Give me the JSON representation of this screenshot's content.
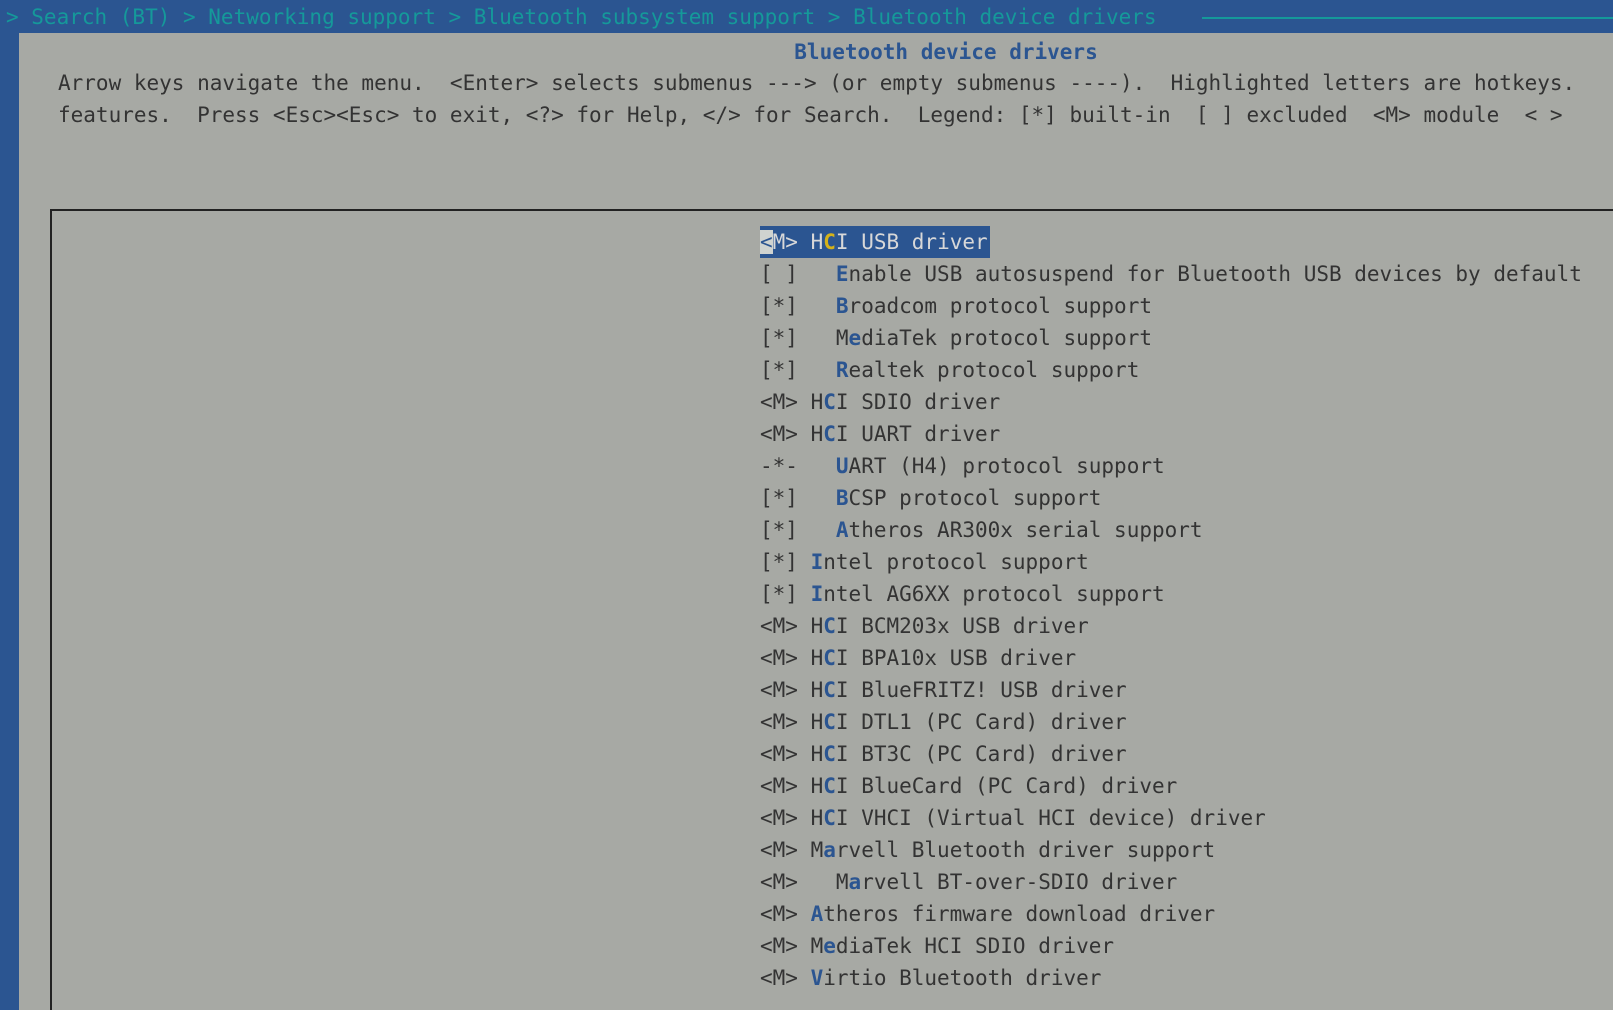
{
  "breadcrumb": "> Search (BT) > Networking support > Bluetooth subsystem support > Bluetooth device drivers",
  "title": "Bluetooth device drivers",
  "help": {
    "line1": "Arrow keys navigate the menu.  <Enter> selects submenus ---> (or empty submenus ----).  Highlighted letters are hotkeys.",
    "line2": "features.  Press <Esc><Esc> to exit, <?> for Help, </> for Search.  Legend: [*] built-in  [ ] excluded  <M> module  < >"
  },
  "colors": {
    "frame_blue": "#2b5591",
    "panel_gray": "#a7a9a4",
    "breadcrumb_teal": "#15999a",
    "hotkey_selected": "#d4b21a"
  },
  "menu": [
    {
      "state": "<M>",
      "indent": "",
      "hot": "C",
      "hot_index": 1,
      "label": "HCI USB driver",
      "selected": true
    },
    {
      "state": "[ ]",
      "indent": "  ",
      "hot": "E",
      "hot_index": 0,
      "label": "Enable USB autosuspend for Bluetooth USB devices by default",
      "selected": false
    },
    {
      "state": "[*]",
      "indent": "  ",
      "hot": "B",
      "hot_index": 0,
      "label": "Broadcom protocol support",
      "selected": false
    },
    {
      "state": "[*]",
      "indent": "  ",
      "hot": "e",
      "hot_index": 1,
      "label": "MediaTek protocol support",
      "selected": false
    },
    {
      "state": "[*]",
      "indent": "  ",
      "hot": "R",
      "hot_index": 0,
      "label": "Realtek protocol support",
      "selected": false
    },
    {
      "state": "<M>",
      "indent": "",
      "hot": "C",
      "hot_index": 1,
      "label": "HCI SDIO driver",
      "selected": false
    },
    {
      "state": "<M>",
      "indent": "",
      "hot": "C",
      "hot_index": 1,
      "label": "HCI UART driver",
      "selected": false
    },
    {
      "state": "-*-",
      "indent": "  ",
      "hot": "U",
      "hot_index": 0,
      "label": "UART (H4) protocol support",
      "selected": false
    },
    {
      "state": "[*]",
      "indent": "  ",
      "hot": "B",
      "hot_index": 0,
      "label": "BCSP protocol support",
      "selected": false
    },
    {
      "state": "[*]",
      "indent": "  ",
      "hot": "A",
      "hot_index": 0,
      "label": "Atheros AR300x serial support",
      "selected": false
    },
    {
      "state": "[*]",
      "indent": "",
      "hot": "I",
      "hot_index": 0,
      "label": "Intel protocol support",
      "selected": false
    },
    {
      "state": "[*]",
      "indent": "",
      "hot": "I",
      "hot_index": 0,
      "label": "Intel AG6XX protocol support",
      "selected": false
    },
    {
      "state": "<M>",
      "indent": "",
      "hot": "C",
      "hot_index": 1,
      "label": "HCI BCM203x USB driver",
      "selected": false
    },
    {
      "state": "<M>",
      "indent": "",
      "hot": "C",
      "hot_index": 1,
      "label": "HCI BPA10x USB driver",
      "selected": false
    },
    {
      "state": "<M>",
      "indent": "",
      "hot": "C",
      "hot_index": 1,
      "label": "HCI BlueFRITZ! USB driver",
      "selected": false
    },
    {
      "state": "<M>",
      "indent": "",
      "hot": "C",
      "hot_index": 1,
      "label": "HCI DTL1 (PC Card) driver",
      "selected": false
    },
    {
      "state": "<M>",
      "indent": "",
      "hot": "C",
      "hot_index": 1,
      "label": "HCI BT3C (PC Card) driver",
      "selected": false
    },
    {
      "state": "<M>",
      "indent": "",
      "hot": "C",
      "hot_index": 1,
      "label": "HCI BlueCard (PC Card) driver",
      "selected": false
    },
    {
      "state": "<M>",
      "indent": "",
      "hot": "C",
      "hot_index": 1,
      "label": "HCI VHCI (Virtual HCI device) driver",
      "selected": false
    },
    {
      "state": "<M>",
      "indent": "",
      "hot": "a",
      "hot_index": 1,
      "label": "Marvell Bluetooth driver support",
      "selected": false
    },
    {
      "state": "<M>",
      "indent": "  ",
      "hot": "a",
      "hot_index": 1,
      "label": "Marvell BT-over-SDIO driver",
      "selected": false
    },
    {
      "state": "<M>",
      "indent": "",
      "hot": "A",
      "hot_index": 0,
      "label": "Atheros firmware download driver",
      "selected": false
    },
    {
      "state": "<M>",
      "indent": "",
      "hot": "e",
      "hot_index": 1,
      "label": "MediaTek HCI SDIO driver",
      "selected": false
    },
    {
      "state": "<M>",
      "indent": "",
      "hot": "V",
      "hot_index": 0,
      "label": "Virtio Bluetooth driver",
      "selected": false
    }
  ]
}
